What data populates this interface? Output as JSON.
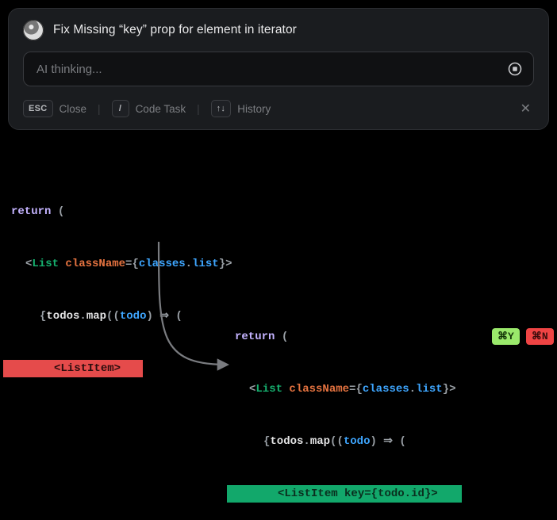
{
  "panel": {
    "title": "Fix Missing “key” prop for element in iterator",
    "input_placeholder": "AI thinking...",
    "esc_key": "ESC",
    "close_label": "Close",
    "slash_key": "/",
    "codetask_label": "Code Task",
    "arrows_key": "↑↓",
    "history_label": "History"
  },
  "badges": {
    "yes": "⌘Y",
    "no": "⌘N"
  },
  "code_before": {
    "kw_return": "return",
    "paren_open": "(",
    "lt": "<",
    "tag_list": "List",
    "attr_class": "className",
    "eq": "=",
    "br_open": "{",
    "cls_classes": "classes",
    "dot": ".",
    "cls_list": "list",
    "br_close": "}",
    "gt": ">",
    "map_open": "{",
    "todos": "todos",
    "dot2": ".",
    "map": "map",
    "fn_open": "((",
    "todo": "todo",
    "fn_close": ")",
    "arrow": "⇒",
    "paren_open2": "(",
    "item_lt": "<",
    "item_tag": "ListItem",
    "item_gt": ">"
  },
  "code_after": {
    "kw_return": "return",
    "paren_open": "(",
    "lt": "<",
    "tag_list": "List",
    "attr_class": "className",
    "eq": "=",
    "br_open": "{",
    "cls_classes": "classes",
    "dot": ".",
    "cls_list": "list",
    "br_close": "}",
    "gt": ">",
    "map_open": "{",
    "todos": "todos",
    "dot2": ".",
    "map": "map",
    "fn_open": "((",
    "todo": "todo",
    "fn_close": ")",
    "arrow": "⇒",
    "paren_open2": "(",
    "item_lt": "<",
    "item_tag": "ListItem",
    "item_attr": "key",
    "item_eq": "=",
    "item_br_open": "{",
    "item_todo": "todo",
    "item_dot": ".",
    "item_id": "id",
    "item_br_close": "}",
    "item_gt": ">"
  }
}
